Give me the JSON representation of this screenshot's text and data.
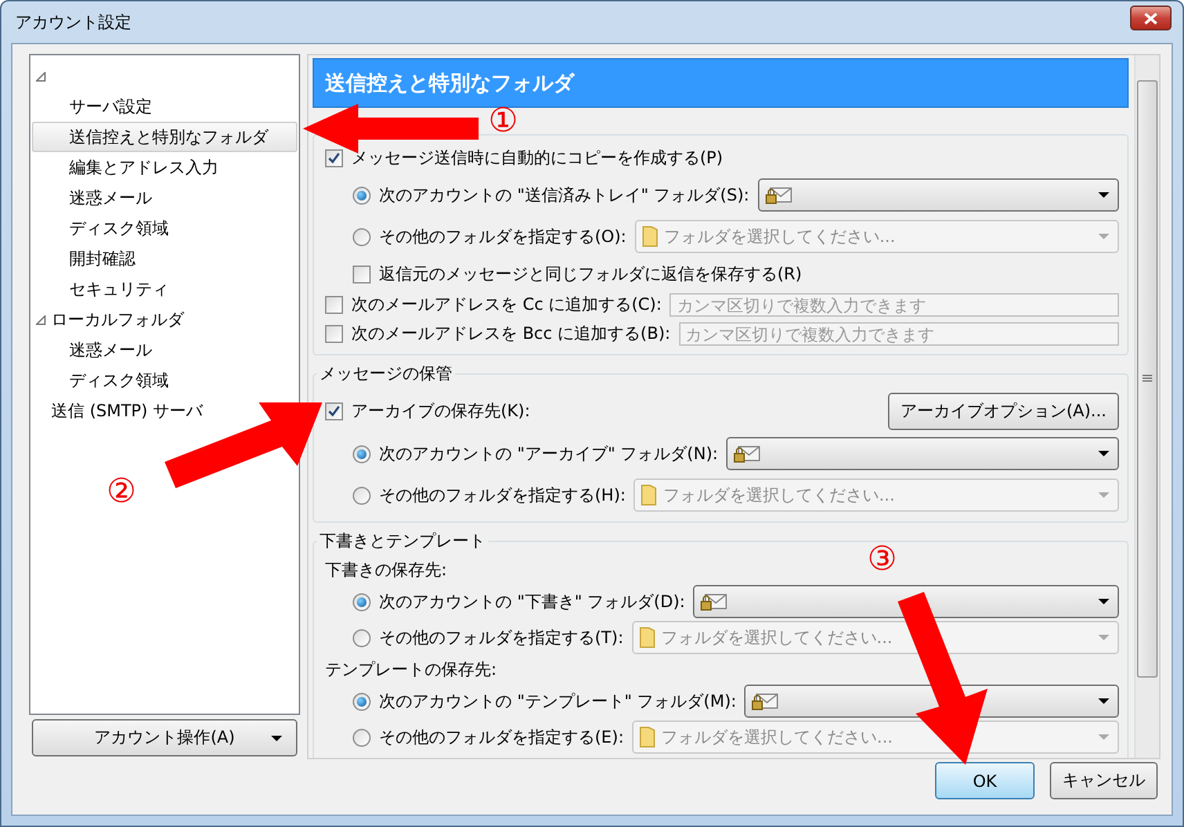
{
  "window": {
    "title": "アカウント設定"
  },
  "tree": [
    {
      "expanded": true,
      "children": [
        {
          "label": "サーバ設定",
          "selected": false
        },
        {
          "label": "送信控えと特別なフォルダ",
          "selected": true
        },
        {
          "label": "編集とアドレス入力",
          "selected": false
        },
        {
          "label": "迷惑メール",
          "selected": false
        },
        {
          "label": "ディスク領域",
          "selected": false
        },
        {
          "label": "開封確認",
          "selected": false
        },
        {
          "label": "セキュリティ",
          "selected": false
        }
      ]
    },
    {
      "label": "ローカルフォルダ",
      "expanded": true,
      "children": [
        {
          "label": "迷惑メール",
          "selected": false
        },
        {
          "label": "ディスク領域",
          "selected": false
        }
      ]
    },
    {
      "label": "送信 (SMTP) サーバ",
      "selected": false
    }
  ],
  "account_actions_button": "アカウント操作(A)",
  "panel": {
    "title": "送信控えと特別なフォルダ",
    "sections": [
      {
        "rows": [
          {
            "kind": "checkbox",
            "label": "メッセージ送信時に自動的にコピーを作成する(P)",
            "checked": true
          },
          {
            "kind": "radio",
            "label": "次のアカウントの \"送信済みトレイ\" フォルダ(S):",
            "selected": true,
            "picker": {
              "kind": "account"
            }
          },
          {
            "kind": "radio",
            "label": "その他のフォルダを指定する(O):",
            "selected": false,
            "picker": {
              "kind": "folder",
              "placeholder": "フォルダを選択してください..."
            }
          },
          {
            "kind": "sub_checkbox",
            "label": "返信元のメッセージと同じフォルダに返信を保存する(R)",
            "checked": false
          },
          {
            "kind": "address",
            "label": "次のメールアドレスを Cc に追加する(C):",
            "checked": false,
            "placeholder": "カンマ区切りで複数入力できます"
          },
          {
            "kind": "address",
            "label": "次のメールアドレスを Bcc に追加する(B):",
            "checked": false,
            "placeholder": "カンマ区切りで複数入力できます"
          }
        ]
      },
      {
        "title": "メッセージの保管",
        "rows": [
          {
            "kind": "checkbox_button",
            "label": "アーカイブの保存先(K):",
            "checked": true,
            "button": "アーカイブオプション(A)..."
          },
          {
            "kind": "radio",
            "label": "次のアカウントの \"アーカイブ\" フォルダ(N):",
            "selected": true,
            "picker": {
              "kind": "account"
            }
          },
          {
            "kind": "radio",
            "label": "その他のフォルダを指定する(H):",
            "selected": false,
            "picker": {
              "kind": "folder",
              "placeholder": "フォルダを選択してください..."
            }
          }
        ]
      },
      {
        "title": "下書きとテンプレート",
        "rows": [
          {
            "kind": "heading",
            "label": "下書きの保存先:"
          },
          {
            "kind": "radio",
            "label": "次のアカウントの \"下書き\" フォルダ(D):",
            "selected": true,
            "picker": {
              "kind": "account"
            }
          },
          {
            "kind": "radio",
            "label": "その他のフォルダを指定する(T):",
            "selected": false,
            "picker": {
              "kind": "folder",
              "placeholder": "フォルダを選択してください..."
            }
          },
          {
            "kind": "heading",
            "label": "テンプレートの保存先:"
          },
          {
            "kind": "radio",
            "label": "次のアカウントの \"テンプレート\" フォルダ(M):",
            "selected": true,
            "picker": {
              "kind": "account"
            }
          },
          {
            "kind": "radio",
            "label": "その他のフォルダを指定する(E):",
            "selected": false,
            "picker": {
              "kind": "folder",
              "placeholder": "フォルダを選択してください..."
            }
          }
        ]
      }
    ]
  },
  "buttons": [
    {
      "label": "OK",
      "default": true
    },
    {
      "label": "キャンセル",
      "default": false
    }
  ],
  "annotations": [
    {
      "text": "①"
    },
    {
      "text": "②"
    },
    {
      "text": "③"
    }
  ]
}
